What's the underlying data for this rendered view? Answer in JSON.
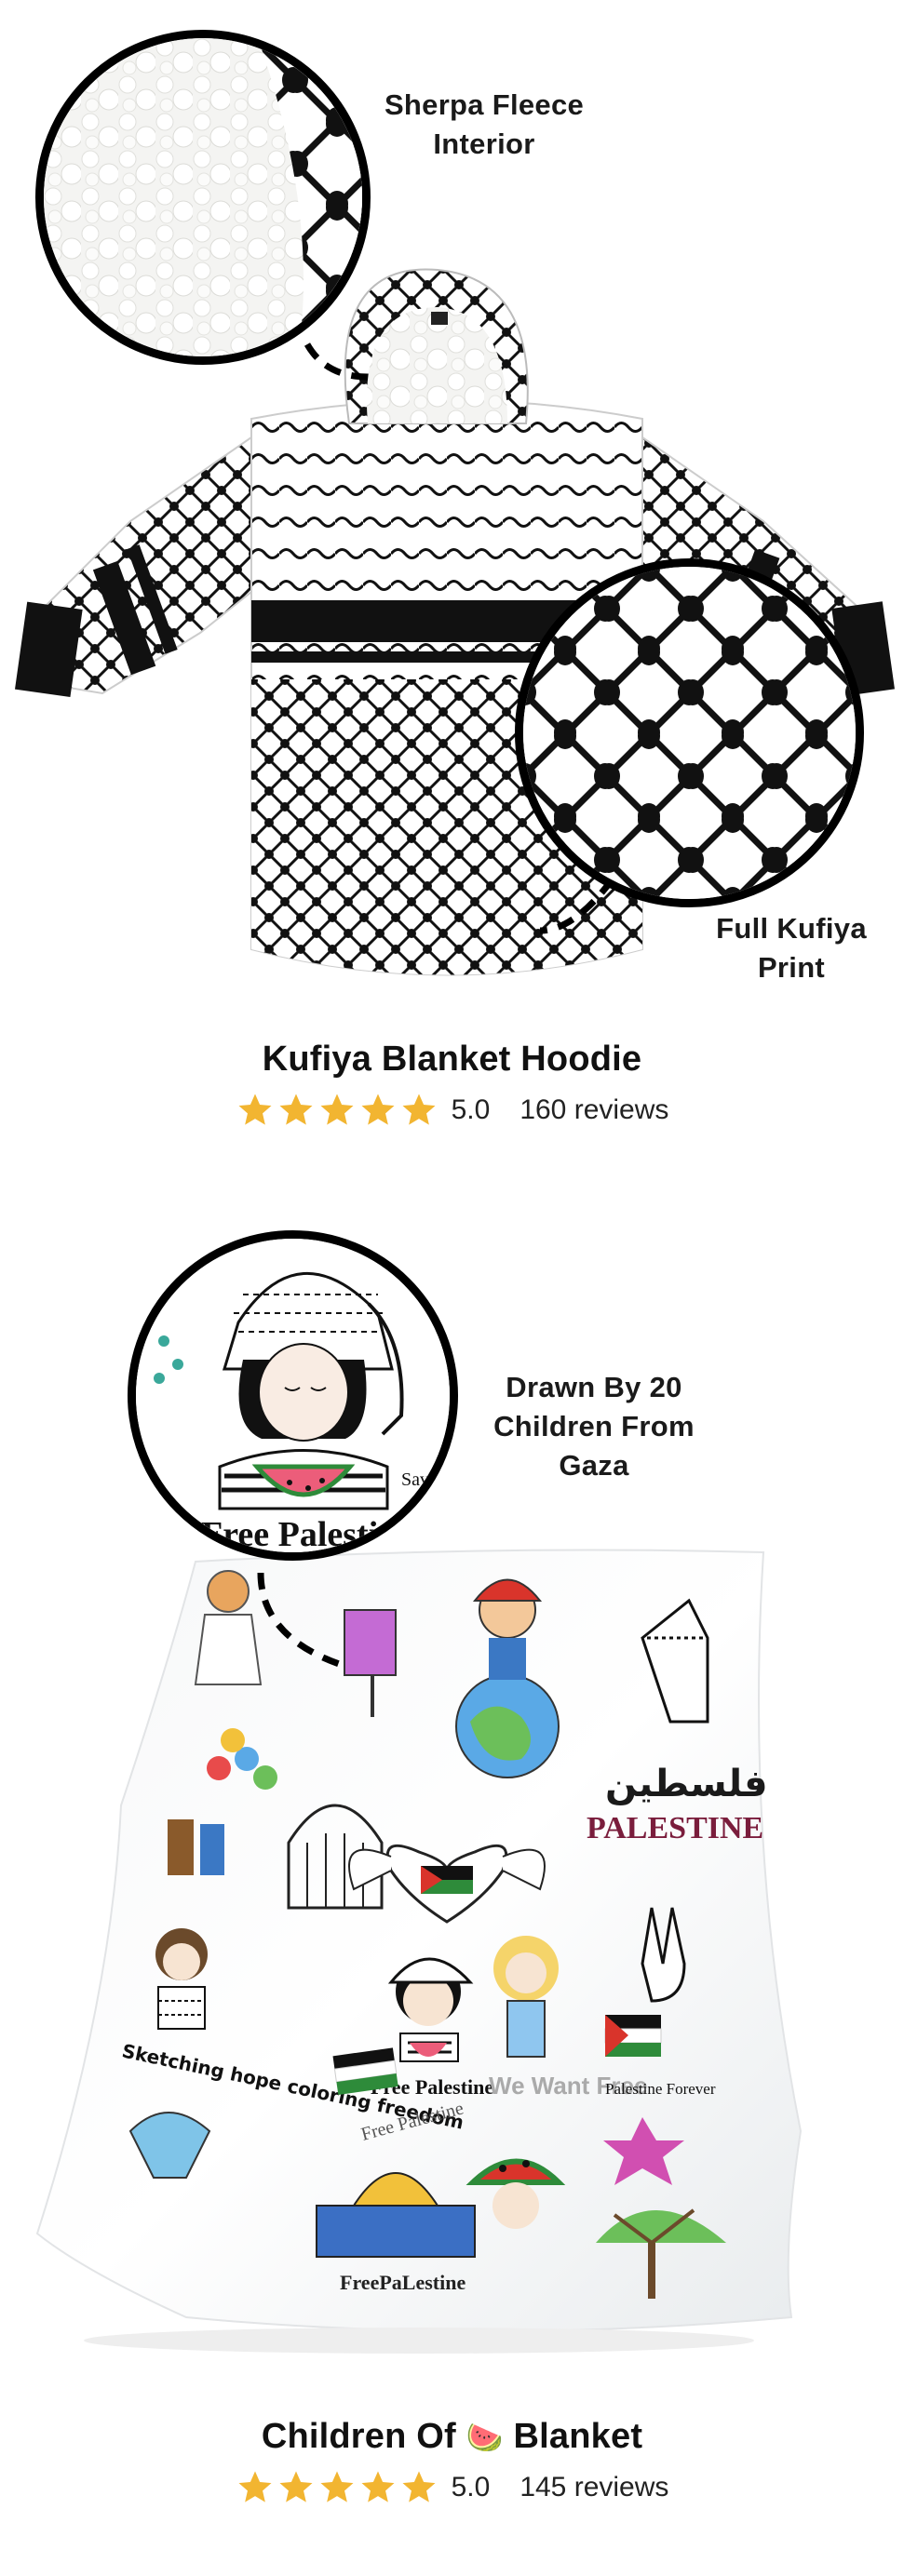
{
  "products": [
    {
      "name": "Kufiya Blanket Hoodie",
      "rating": "5.0",
      "reviews": "160 reviews",
      "stars": 5,
      "callouts": [
        "Sherpa Fleece\nInterior",
        "Full Kufiya\nPrint"
      ]
    },
    {
      "name_part1": "Children Of",
      "name_emoji": "🍉",
      "name_part2": "Blanket",
      "rating": "5.0",
      "reviews": "145 reviews",
      "stars": 5,
      "callouts": [
        "Drawn By 20\nChildren From\nGaza"
      ],
      "blanket_texts": [
        "PALESTINE",
        "Free Palestine",
        "Free Palestine",
        "FreePaLestine",
        "Sketching hope coloring freedom",
        "We Want Free",
        "Palestine Forever"
      ]
    }
  ],
  "colors": {
    "star": "#f2b531",
    "text": "#111111",
    "accent_red": "#d9342b",
    "accent_green": "#2e8b3a"
  }
}
